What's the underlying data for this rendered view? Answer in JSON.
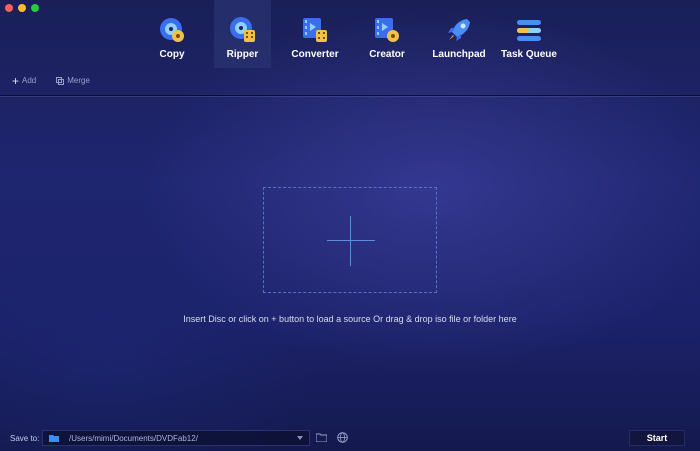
{
  "window": {
    "controls": [
      "close",
      "minimize",
      "zoom"
    ]
  },
  "nav": {
    "items": [
      {
        "label": "Copy",
        "icon": "disc-copy-icon",
        "active": false
      },
      {
        "label": "Ripper",
        "icon": "disc-ripper-icon",
        "active": true
      },
      {
        "label": "Converter",
        "icon": "film-converter-icon",
        "active": false
      },
      {
        "label": "Creator",
        "icon": "film-creator-icon",
        "active": false
      },
      {
        "label": "Launchpad",
        "icon": "rocket-icon",
        "active": false
      },
      {
        "label": "Task Queue",
        "icon": "task-queue-icon",
        "active": false
      }
    ]
  },
  "toolbar": {
    "add_label": "Add",
    "merge_label": "Merge"
  },
  "dropzone": {
    "hint": "Insert Disc or click on + button to load a source Or drag & drop iso file or folder here"
  },
  "bottom": {
    "save_label": "Save to:",
    "path": "/Users/mimi/Documents/DVDFab12/",
    "start_label": "Start"
  },
  "colors": {
    "accent": "#4a78c8",
    "background": "#1f2670",
    "active_tab": "#28306e"
  }
}
